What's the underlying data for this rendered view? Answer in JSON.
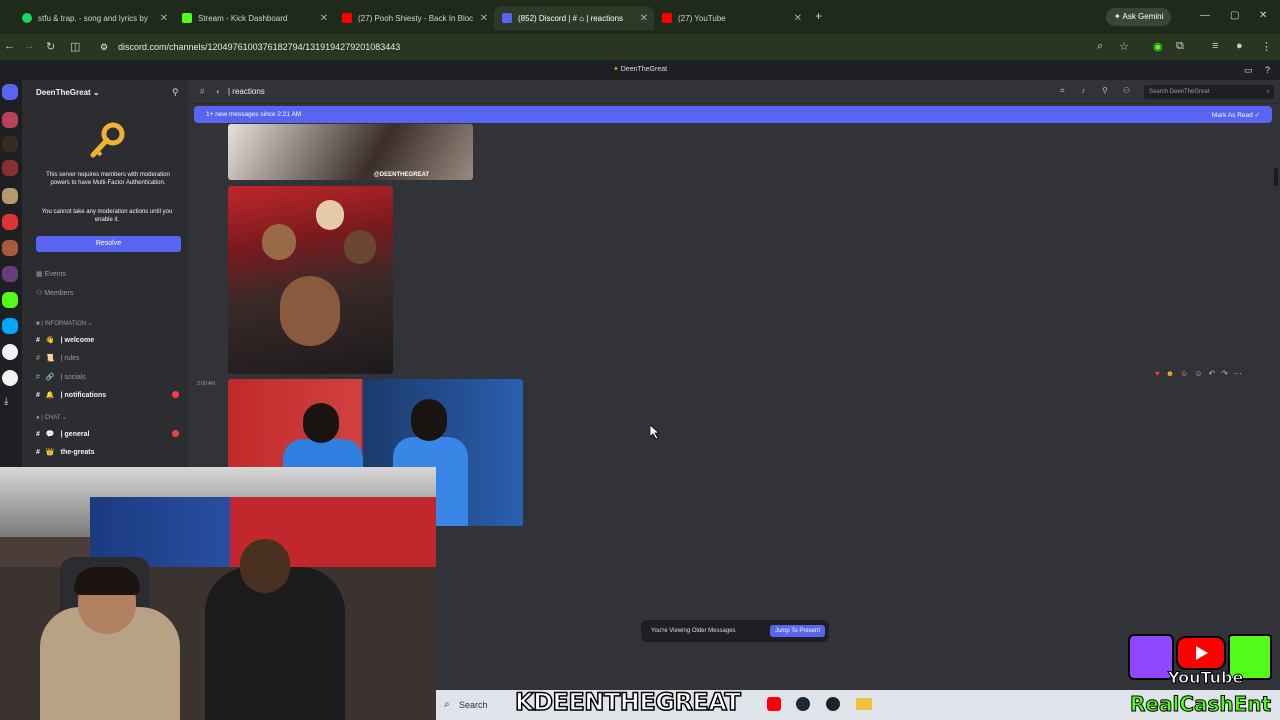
{
  "browser": {
    "tabs": [
      {
        "label": "stfu & trap. - song and lyrics by",
        "color": "#1ed760"
      },
      {
        "label": "Stream - Kick Dashboard",
        "color": "#53fc18"
      },
      {
        "label": "(27) Pooh Shiesty - Back In Bloc",
        "color": "#ff0000"
      },
      {
        "label": "(852) Discord | # ⌂ | reactions",
        "color": "#5865f2"
      },
      {
        "label": "(27) YouTube",
        "color": "#ff0000"
      }
    ],
    "new_tab": "+",
    "ask_gemini": "Ask Gemini",
    "url": "discord.com/channels/1204976100376182794/1319194279201083443"
  },
  "discord": {
    "window_title": "DeenTheGreat",
    "server_name": "DeenTheGreat",
    "mfa_text": "This server requires members with moderation powers to have Multi-Factor Authentication.",
    "mfa_text2": "You cannot take any moderation actions until you enable it.",
    "resolve_label": "Resolve",
    "nav": {
      "events": "Events",
      "members": "Members"
    },
    "category_info": "| INFORMATION",
    "category_chat": "| CHAT",
    "channels": [
      {
        "name": "| welcome",
        "bold": true
      },
      {
        "name": "| rules",
        "bold": false
      },
      {
        "name": "| socials",
        "bold": false
      },
      {
        "name": "| notifications",
        "bold": true
      },
      {
        "name": "| general",
        "bold": true
      },
      {
        "name": "the-greats",
        "bold": true
      }
    ],
    "channel_header": "| reactions",
    "search_placeholder": "Search DeenTheGreat",
    "new_messages": "1+ new messages since 2:21 AM",
    "mark_as_read": "Mark As Read",
    "timestamp": "3:00 AM",
    "watermark": "@DEENTHEGREAT",
    "older_text": "You're Viewing Older Messages",
    "jump_label": "Jump To Present"
  },
  "taskbar": {
    "search": "Search"
  },
  "overlay": {
    "banner": "KDEENTHEGREAT",
    "youtube": "YouTube",
    "realcash": "RealCashEnt"
  }
}
